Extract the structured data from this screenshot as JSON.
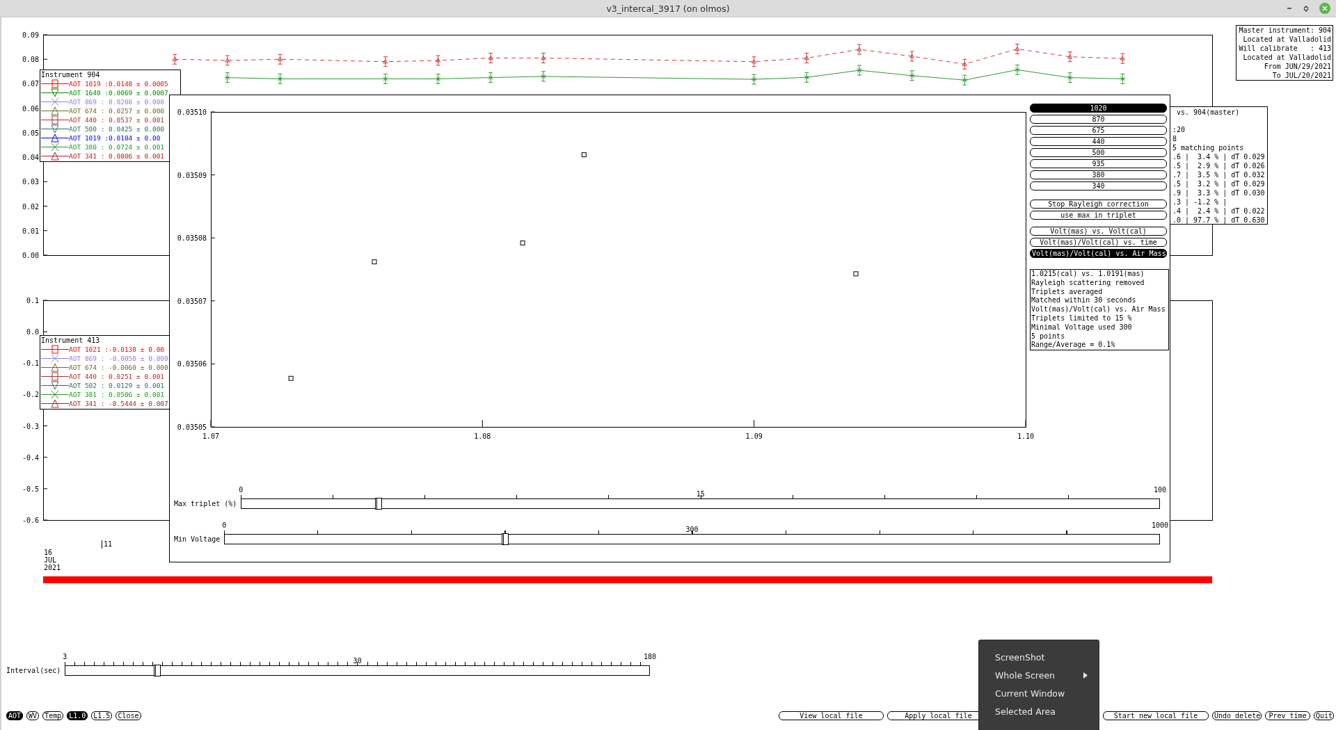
{
  "window": {
    "title": "v3_intercal_3917 (on olmos)"
  },
  "aot_chart": {
    "y_axis_labels": [
      "0.09",
      "0.08",
      "0.07",
      "0.06",
      "0.05",
      "0.04",
      "0.03",
      "0.02",
      "0.01",
      "0.00"
    ]
  },
  "legend_master": {
    "title": "Instrument 904",
    "items": [
      {
        "kind": "square",
        "label": "AOT 1019 :",
        "value": "0.0148 ± 0.0005",
        "color": "#ff0000"
      },
      {
        "kind": "triangle-down",
        "label": "AOT 1640 :",
        "value": "0.0069 ± 0.0007",
        "color": "#008b00"
      },
      {
        "kind": "cross",
        "label": "AOT 869 :",
        "value": "0.0208 ± 0.000",
        "color": "#8f7ee0"
      },
      {
        "kind": "triangle-up",
        "label": "AOT 674 :",
        "value": "0.0257 ± 0.000",
        "color": "#6b6b2a"
      },
      {
        "kind": "square",
        "label": "AOT 440 :",
        "value": "0.0537 ± 0.001",
        "color": "#a83232"
      },
      {
        "kind": "triangle-down",
        "label": "AOT 500 :",
        "value": "0.0425 ± 0.000",
        "color": "#2f6f55"
      },
      {
        "kind": "triangle-up",
        "label": "AOT 1019 :",
        "value": "0.0184 ± 0.00",
        "color": "#0000ff"
      },
      {
        "kind": "cross",
        "label": "AOT 380 :",
        "value": "0.0724 ± 0.001",
        "color": "#229922"
      },
      {
        "kind": "triangle-up",
        "label": "AOT 341 :",
        "value": "0.0806 ± 0.001",
        "color": "#b22222"
      }
    ]
  },
  "calibrated_chart": {
    "y_axis_labels": [
      "0.1",
      "0.0",
      "-0.1",
      "-0.2",
      "-0.3",
      "-0.4",
      "-0.5",
      "-0.6"
    ]
  },
  "legend_calibrated": {
    "title": "Instrument 413",
    "items": [
      {
        "kind": "square",
        "label": "AOT 1021 :",
        "value": "-0.0138 ± 0.00",
        "color": "#ff0000"
      },
      {
        "kind": "cross",
        "label": "AOT 869 :",
        "value": "-0.0050 ± 0.000",
        "color": "#8f7ee0"
      },
      {
        "kind": "triangle-up",
        "label": "AOT 674 :",
        "value": "-0.0060 ± 0.000",
        "color": "#6b6b2a"
      },
      {
        "kind": "square",
        "label": "AOT 440 :",
        "value": "0.0251 ± 0.001",
        "color": "#a83232"
      },
      {
        "kind": "triangle-down",
        "label": "AOT 502 :",
        "value": "0.0129 ± 0.001",
        "color": "#2f6f55"
      },
      {
        "kind": "cross",
        "label": "AOT 381 :",
        "value": "0.0506 ± 0.001",
        "color": "#229922"
      },
      {
        "kind": "triangle-up",
        "label": "AOT 341 :",
        "value": "-0.5444 ± 0.007",
        "color": "#b22222"
      }
    ]
  },
  "time_axis": {
    "tick_label": "11",
    "date_lines": [
      "16",
      "JUL",
      "2021"
    ]
  },
  "master_info": [
    "Master instrument: 904",
    "Located at Valladolid",
    "Will calibrate   : 413",
    "Located at Valladolid",
    "From JUN/29/2021",
    "To JUL/20/2021"
  ],
  "stats_panel": [
    {
      "kind": "header",
      "text": "vs. 904(master)"
    },
    {
      "kind": "line",
      "text": ":20"
    },
    {
      "kind": "line",
      "text": "8"
    },
    {
      "kind": "line",
      "text": "5 matching points"
    },
    {
      "kind": "line",
      "text": ".6 |  3.4 % | dT 0.029"
    },
    {
      "kind": "line",
      "text": ".5 |  2.9 % | dT 0.026"
    },
    {
      "kind": "line",
      "text": ".7 |  3.5 % | dT 0.032"
    },
    {
      "kind": "line",
      "text": ".5 |  3.2 % | dT 0.029"
    },
    {
      "kind": "line",
      "text": ".9 |  3.3 % | dT 0.030"
    },
    {
      "kind": "line",
      "text": ".3 | -1.2 % |"
    },
    {
      "kind": "line",
      "text": ".4 |  2.4 % | dT 0.022"
    },
    {
      "kind": "line",
      "text": ".0 | 97.7 % | dT 0.630"
    }
  ],
  "dialog": {
    "chart_data": {
      "type": "scatter",
      "xlim": [
        1.07,
        1.1
      ],
      "ylim": [
        0.03505,
        0.0351
      ],
      "xticks": [
        {
          "value": 1.07,
          "label": "1.07"
        },
        {
          "value": 1.08,
          "label": "1.08"
        },
        {
          "value": 1.09,
          "label": "1.09"
        },
        {
          "value": 1.1,
          "label": "1.10"
        }
      ],
      "yticks": [
        {
          "value": 0.03505,
          "label": "0.03505"
        },
        {
          "value": 0.03506,
          "label": "0.03506"
        },
        {
          "value": 0.03507,
          "label": "0.03507"
        },
        {
          "value": 0.03508,
          "label": "0.03508"
        },
        {
          "value": 0.03509,
          "label": "0.03509"
        },
        {
          "value": 0.0351,
          "label": "0.03510"
        }
      ],
      "x": [
        1.07295,
        1.07602,
        1.08148,
        1.08374,
        1.09375
      ],
      "series": [
        {
          "color": "#000000",
          "values": [
            0.0350577,
            0.0350762,
            0.0350792,
            0.0350932,
            0.0350743
          ]
        }
      ]
    },
    "wavelength_buttons": [
      {
        "label": "1020",
        "selected": true
      },
      {
        "label": "870",
        "selected": false
      },
      {
        "label": "675",
        "selected": false
      },
      {
        "label": "440",
        "selected": false
      },
      {
        "label": "500",
        "selected": false
      },
      {
        "label": "935",
        "selected": false
      },
      {
        "label": "380",
        "selected": false
      },
      {
        "label": "340",
        "selected": false
      }
    ],
    "option_buttons": [
      {
        "label": "Stop Rayleigh correction",
        "selected": false
      },
      {
        "label": "use max in triplet",
        "selected": false
      }
    ],
    "plot_mode_buttons": [
      {
        "label": "Volt(mas) vs. Volt(cal)",
        "selected": false
      },
      {
        "label": "Volt(mas)/Volt(cal) vs. time",
        "selected": false
      },
      {
        "label": "Volt(mas)/Volt(cal) vs. Air Mass",
        "selected": true
      }
    ],
    "summary": [
      "1.0215(cal) vs. 1.0191(mas)",
      "Rayleigh scattering removed",
      "Triplets averaged",
      "Matched within 30 seconds",
      "Volt(mas)/Volt(cal) vs. Air Mass",
      "Triplets limited to 15 %",
      "Minimal Voltage used 300",
      "5 points",
      "Range/Average = 0.1%"
    ],
    "sliders": [
      {
        "label": "Max triplet (%)",
        "min": "0",
        "mid": "15",
        "max": "100",
        "level": 0.149
      },
      {
        "label": "Min Voltage",
        "min": "0",
        "mid": "300",
        "max": "1000",
        "level": 0.3
      }
    ]
  },
  "interval_slider": {
    "label": "Interval(sec)",
    "min": "3",
    "mid": "30",
    "max": "180",
    "level": 0.157
  },
  "mode_buttons": [
    {
      "label": "AOT",
      "selected": true
    },
    {
      "label": "WV",
      "selected": false
    },
    {
      "label": "Temp",
      "selected": false
    },
    {
      "label": "L1.0",
      "selected": true
    },
    {
      "label": "L1.5",
      "selected": false
    },
    {
      "label": "Close",
      "selected": false
    }
  ],
  "file_buttons": [
    "View local file",
    "Apply local file",
    "Start new local file",
    "Undo delete",
    "Prev time",
    "Quit"
  ],
  "context_menu": [
    {
      "kind": "header",
      "label": "ScreenShot"
    },
    {
      "kind": "submenu",
      "label": "Whole Screen"
    },
    {
      "kind": "item",
      "label": "Current Window"
    },
    {
      "kind": "item",
      "label": "Selected Area"
    }
  ]
}
